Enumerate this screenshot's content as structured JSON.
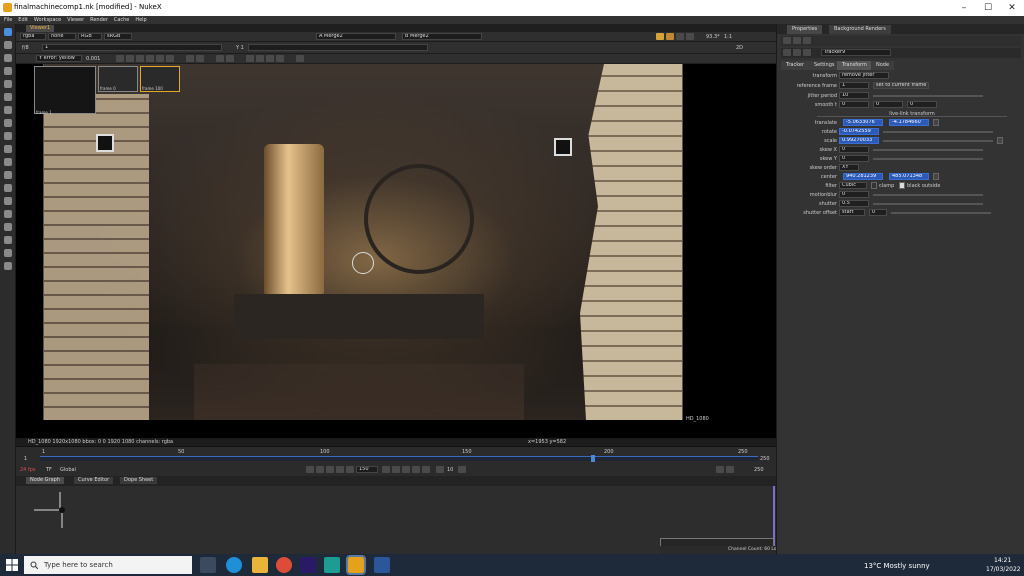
{
  "window": {
    "title": "finalmachinecomp1.nk [modified] - NukeX",
    "controls": [
      "–",
      "☐",
      "✕"
    ]
  },
  "menu": [
    "File",
    "Edit",
    "Workspace",
    "Viewer",
    "Render",
    "Cache",
    "Help"
  ],
  "viewer": {
    "tab": "Viewer1",
    "channels": "rgba",
    "alpha": "none",
    "colorspace": "RGB",
    "display": "sRGB",
    "input_a": "A Merge2",
    "input_b": "B Merge2",
    "fstop": "f/8",
    "frame_field": "1",
    "gain_label": "Y 1",
    "zoom": "93.3*",
    "ratio": "1:1",
    "view_mode": "2D",
    "error_label": "Y error: yellow",
    "error_value": "0.001",
    "format_label": "HD_1080",
    "info": "HD_1080 1920x1080  bbox: 0 0 1920 1080 channels: rgba",
    "coords": "x=1953 y=582",
    "thumbs": [
      "frame 1",
      "frame 0",
      "frame 100"
    ]
  },
  "timeline": {
    "start": "1",
    "end": "250",
    "ticks": [
      "1",
      "50",
      "100",
      "150",
      "200",
      "250"
    ],
    "current_frame": "193",
    "current_fraction": 0.77,
    "fps_label": "24 fps",
    "tf_label": "TF",
    "global_label": "Global",
    "step_value": "10",
    "frame_field": "150",
    "end_field": "250"
  },
  "panels": {
    "tabs": [
      "Node Graph",
      "Curve Editor",
      "Dope Sheet"
    ]
  },
  "properties": {
    "tabs": [
      "Properties",
      "Background Renders"
    ],
    "node_name": "Tracker9",
    "node_tabs": [
      "Tracker",
      "Settings",
      "Transform",
      "Node"
    ],
    "active_tab": "Transform",
    "knobs": {
      "transform_label": "transform",
      "transform_value": "remove jitter",
      "reference_frame_label": "reference frame",
      "reference_frame_value": "1",
      "set_current_label": "set to current frame",
      "jitter_period_label": "jitter period",
      "jitter_period_value": "10",
      "smooth_label": "smooth t",
      "smooth_values": [
        "0",
        "0",
        "0"
      ],
      "live_link_label": "live-link transform",
      "translate_label": "translate",
      "translate_x": "-5.0633076",
      "translate_y": "-4.1784660",
      "rotate_label": "rotate",
      "rotate_value": "-0.0742559",
      "scale_label": "scale",
      "scale_value": "0.99270033",
      "skew_x_label": "skew X",
      "skew_x_value": "0",
      "skew_y_label": "skew Y",
      "skew_y_value": "0",
      "skew_order_label": "skew order",
      "skew_order_value": "XY",
      "center_label": "center",
      "center_x": "940.281239",
      "center_y": "485.071348",
      "filter_label": "filter",
      "filter_value": "Cubic",
      "clamp_label": "clamp",
      "black_outside_label": "black outside",
      "motionblur_label": "motionblur",
      "motionblur_value": "0",
      "shutter_label": "shutter",
      "shutter_value": "0.5",
      "shutter_offset_label": "shutter offset",
      "shutter_offset_value": "start",
      "shutter_offset_num": "0"
    }
  },
  "status": "Channel Count: 60  Localization Mode: On  Memory: 5.0 GB (60.2%)  CPU: 316.0%  Disk: 60.9 MB/s  Network: 10.0 MB/s",
  "taskbar": {
    "search_placeholder": "Type here to search",
    "weather": "13°C  Mostly sunny",
    "time": "14:21",
    "date": "17/03/2022"
  }
}
